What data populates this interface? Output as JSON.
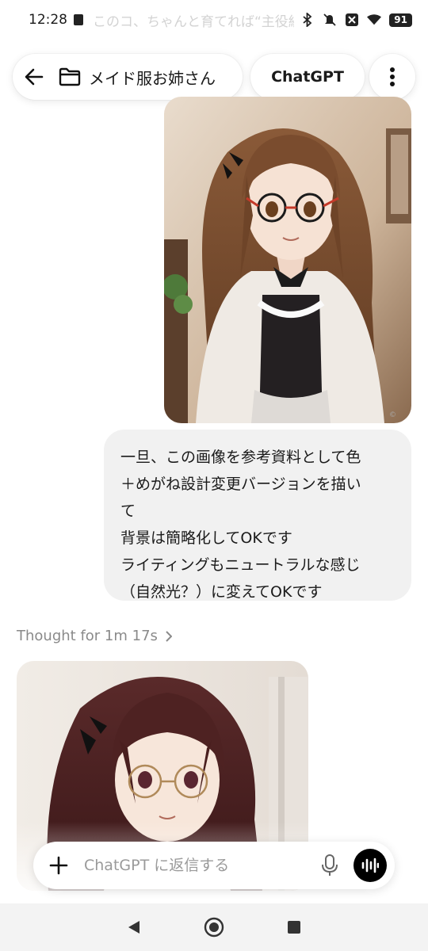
{
  "status_bar": {
    "time": "12:28",
    "faded_text": "このコ、ちゃんと育てれば“主役級”になりますよ",
    "battery": "91"
  },
  "header": {
    "back_icon": "arrow-left-icon",
    "folder_icon": "folder-icon",
    "title": "メイド服お姉さん",
    "model_label": "ChatGPT",
    "more_icon": "more-vertical-icon"
  },
  "messages": {
    "generated_image_1_alt": "maid-illustration-brown-hair",
    "user_bubble_lines": [
      "一旦、この画像を参考資料として色",
      "＋めがね設計変更バージョンを描い",
      "て",
      "背景は簡略化してOKです",
      "ライティングもニュートラルな感じ",
      "（自然光？）に変えてOKです"
    ],
    "thought_label": "Thought for 1m 17s",
    "generated_image_2_alt": "maid-illustration-dark-hair"
  },
  "composer": {
    "placeholder": "ChatGPT に返信する",
    "value": ""
  },
  "colors": {
    "bubble_bg": "#f1f1f1",
    "thought_text": "#8a8a8a",
    "voice_button": "#000000"
  }
}
